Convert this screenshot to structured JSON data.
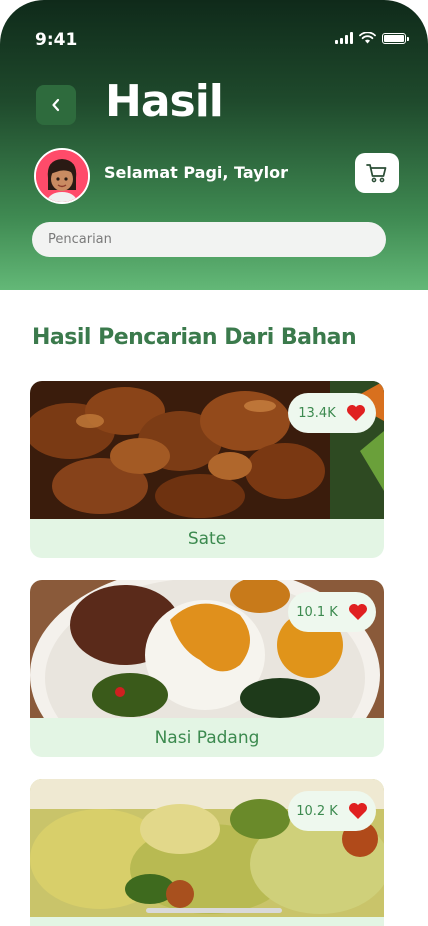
{
  "status_bar": {
    "time": "9:41"
  },
  "header": {
    "title": "Hasil",
    "greeting": "Selamat Pagi, Taylor",
    "search_placeholder": "Pencarian"
  },
  "section": {
    "title": "Hasil Pencarian Dari Bahan"
  },
  "results": [
    {
      "name": "Sate",
      "likes": "13.4K"
    },
    {
      "name": "Nasi Padang",
      "likes": "10.1 K"
    },
    {
      "name": "",
      "likes": "10.2 K"
    }
  ],
  "icons": {
    "back": "chevron-left-icon",
    "cart": "cart-icon",
    "like": "heart-icon",
    "signal": "signal-icon",
    "wifi": "wifi-icon",
    "battery": "battery-icon"
  },
  "colors": {
    "header_dark": "#0f2a1a",
    "header_light": "#63b877",
    "accent_green": "#3b7a4c",
    "card_bg": "#e3f5e4",
    "heart": "#e02020"
  }
}
